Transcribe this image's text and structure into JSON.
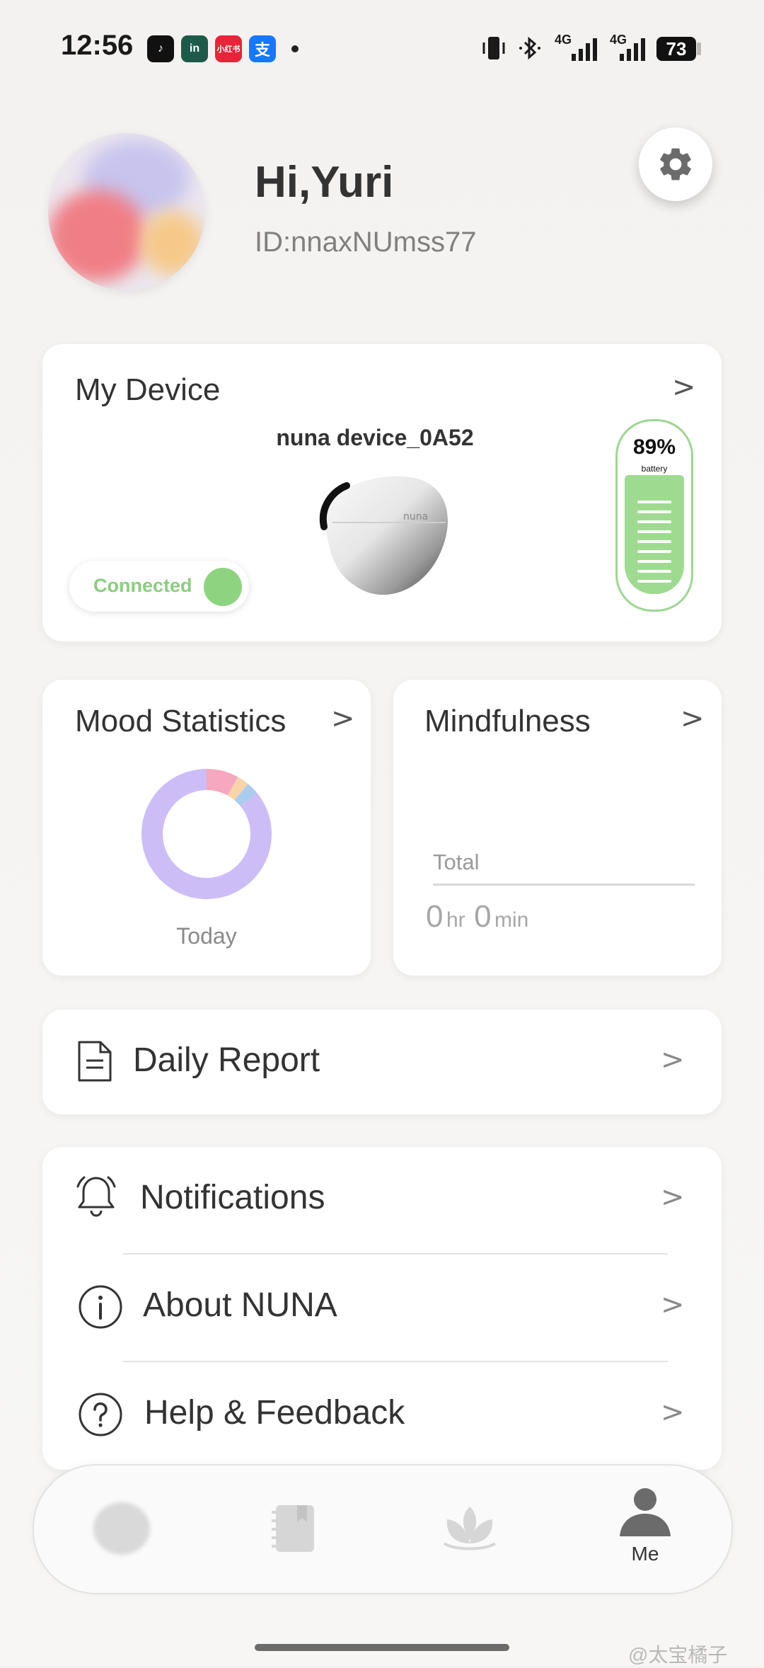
{
  "status_bar": {
    "time": "12:56",
    "apps": [
      "tiktok-icon",
      "linkedin-style-icon",
      "xiaohongshu-icon",
      "alipay-icon"
    ],
    "app_labels": [
      "♪",
      "in",
      "小红书",
      "支"
    ],
    "network1": "4G",
    "network2": "4G",
    "battery": "73"
  },
  "profile": {
    "greeting": "Hi,Yuri",
    "user_id": "ID:nnaxNUmss77"
  },
  "device_card": {
    "title": "My Device",
    "device_name": "nuna device_0A52",
    "device_brand": "nuna",
    "status": "Connected",
    "battery_percent": "89%",
    "battery_label": "battery",
    "battery_level": 0.89
  },
  "mood_card": {
    "title": "Mood Statistics",
    "period": "Today",
    "segments": [
      {
        "color": "#cdbdf7",
        "fraction": 0.86
      },
      {
        "color": "#f6a8c0",
        "fraction": 0.08
      },
      {
        "color": "#f7d5a8",
        "fraction": 0.03
      },
      {
        "color": "#a9cdee",
        "fraction": 0.03
      }
    ]
  },
  "mindfulness_card": {
    "title": "Mindfulness",
    "total_label": "Total",
    "hours": "0",
    "hours_unit": "hr",
    "minutes": "0",
    "minutes_unit": "min"
  },
  "daily_report": {
    "label": "Daily Report"
  },
  "menu": {
    "items": [
      {
        "label": "Notifications",
        "icon": "bell-icon"
      },
      {
        "label": "About NUNA",
        "icon": "info-icon"
      },
      {
        "label": "Help & Feedback",
        "icon": "help-icon"
      }
    ]
  },
  "bottom_nav": {
    "me_label": "Me"
  },
  "watermark": "@太宝橘子"
}
